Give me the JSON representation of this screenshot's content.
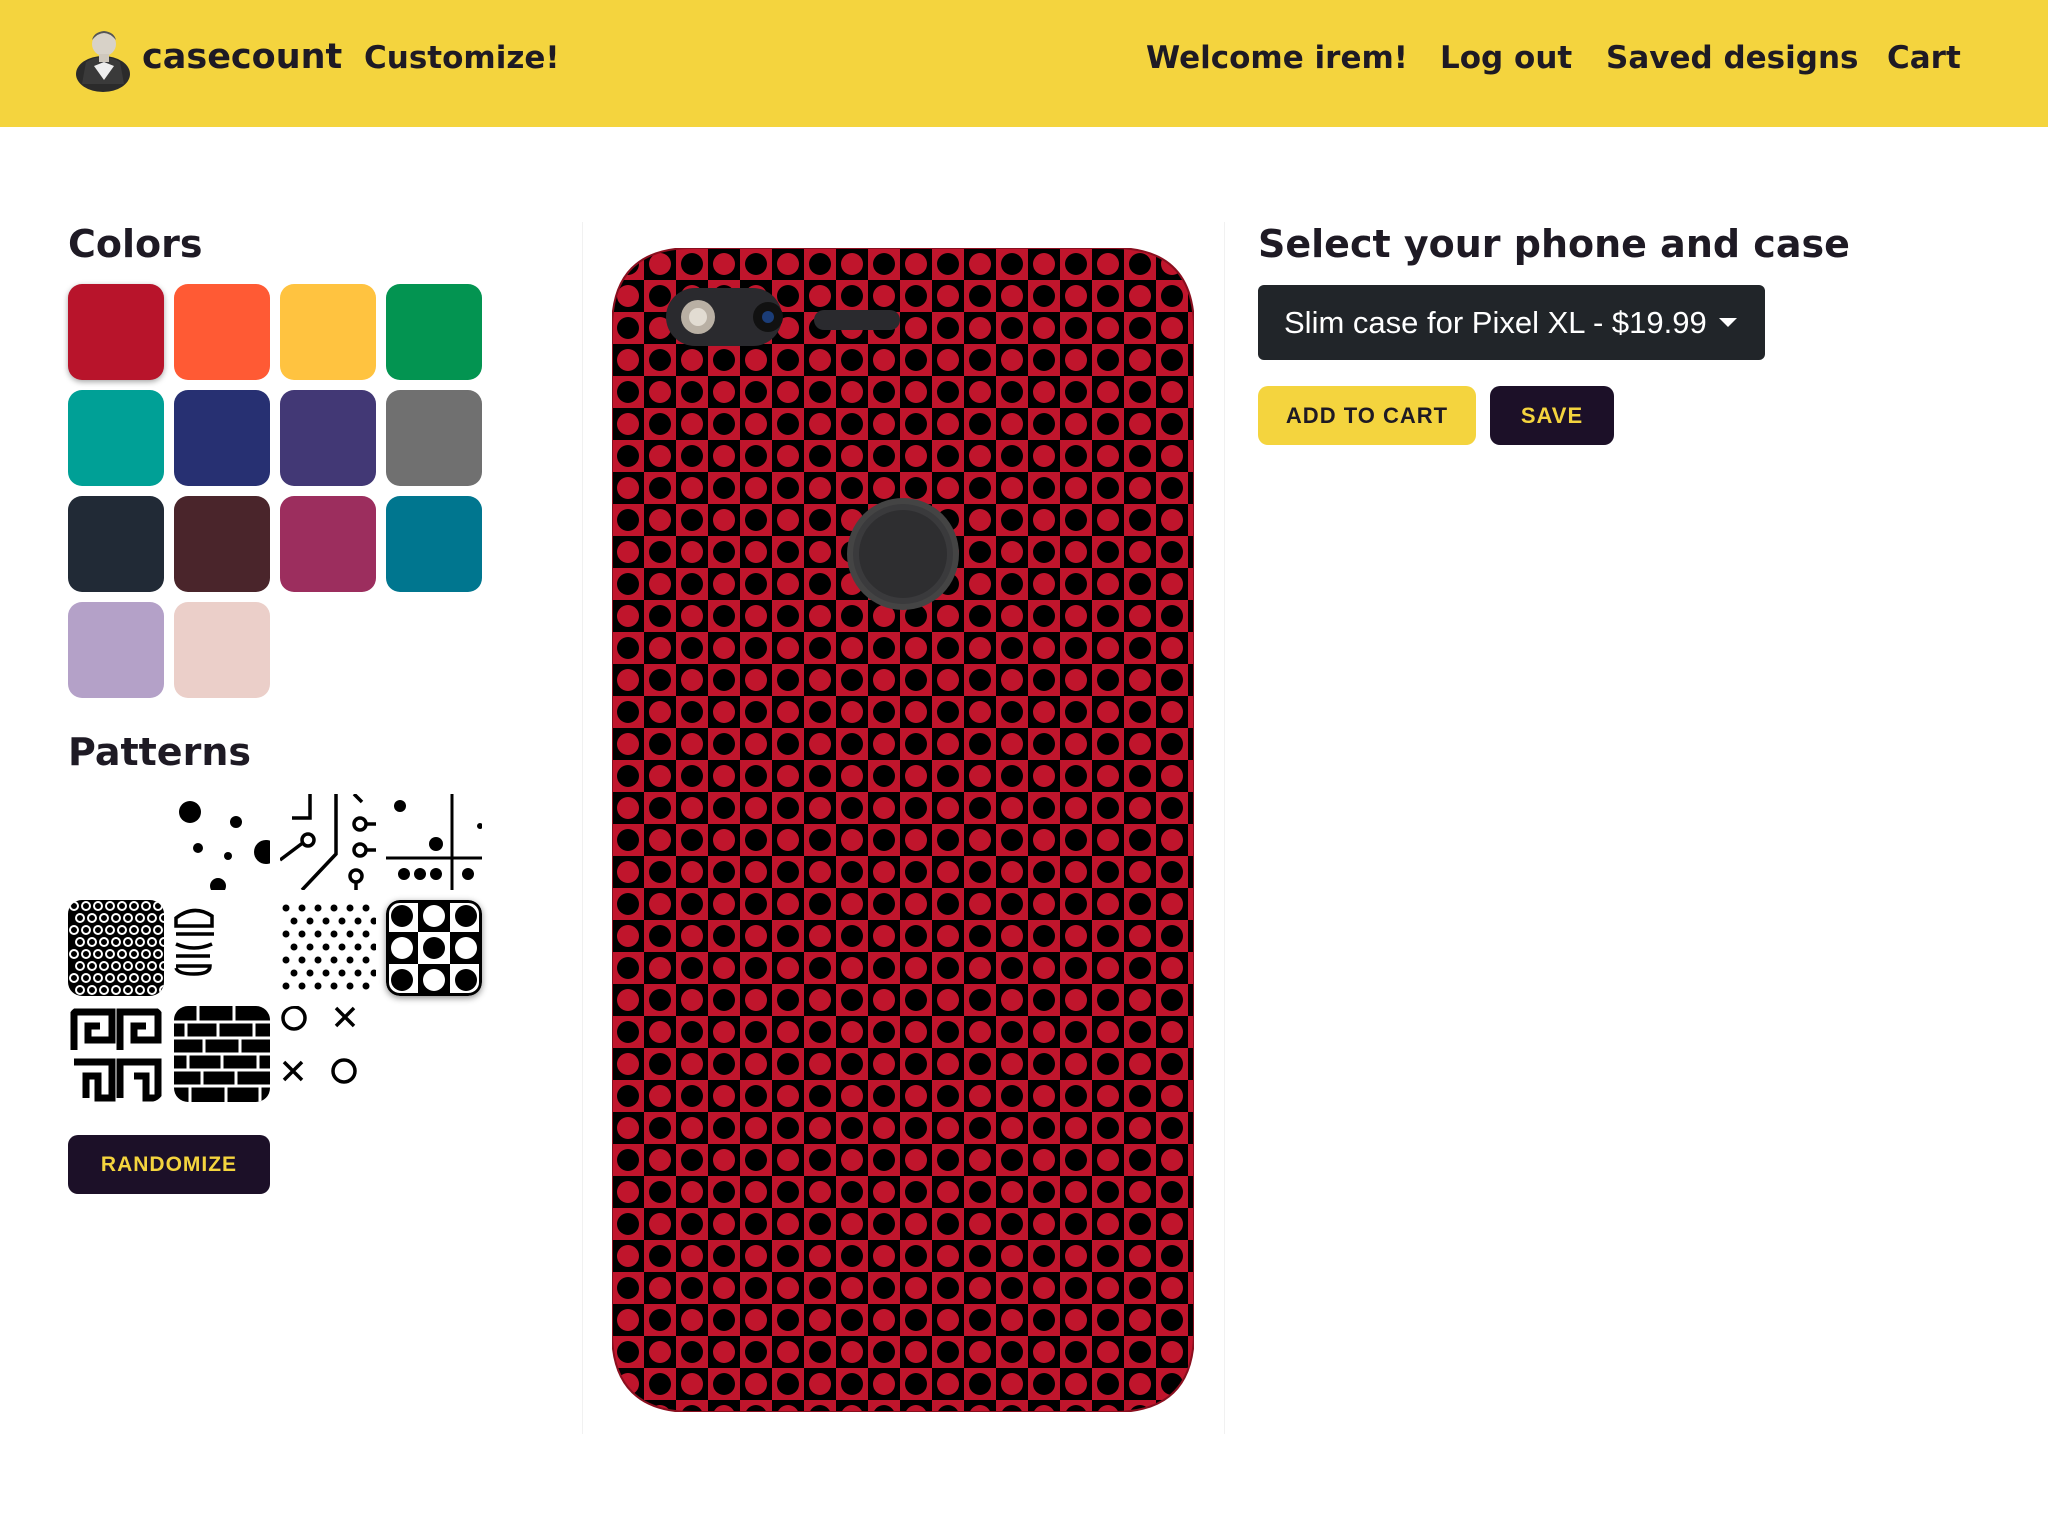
{
  "header": {
    "brand_name": "casecount",
    "brand_logo": "portrait-logo-icon",
    "nav_customize": "Customize!",
    "welcome": "Welcome irem!",
    "logout": "Log out",
    "saved_designs": "Saved designs",
    "cart": "Cart",
    "background_color": "#f4d43e"
  },
  "sidebar": {
    "colors_title": "Colors",
    "colors": [
      {
        "name": "crimson",
        "hex": "#b8142b",
        "selected": true
      },
      {
        "name": "orange",
        "hex": "#ff5a34"
      },
      {
        "name": "yellow",
        "hex": "#ffc340"
      },
      {
        "name": "green",
        "hex": "#039451"
      },
      {
        "name": "teal",
        "hex": "#00a096"
      },
      {
        "name": "navy",
        "hex": "#273072"
      },
      {
        "name": "indigo",
        "hex": "#423875"
      },
      {
        "name": "gray",
        "hex": "#707070"
      },
      {
        "name": "charcoal",
        "hex": "#212a36"
      },
      {
        "name": "maroon",
        "hex": "#4a252b"
      },
      {
        "name": "magenta",
        "hex": "#9c2e5e"
      },
      {
        "name": "petrol",
        "hex": "#00768f"
      },
      {
        "name": "lavender",
        "hex": "#b4a1c8"
      },
      {
        "name": "blush",
        "hex": "#ebcfc9"
      }
    ],
    "patterns_title": "Patterns",
    "patterns": [
      {
        "name": "none-pattern"
      },
      {
        "name": "scattered-dots-pattern"
      },
      {
        "name": "circuit-pattern"
      },
      {
        "name": "cross-dots-pattern"
      },
      {
        "name": "ring-grid-pattern"
      },
      {
        "name": "burger-line-pattern"
      },
      {
        "name": "polka-dots-pattern"
      },
      {
        "name": "checker-circles-pattern",
        "selected": true
      },
      {
        "name": "greek-key-pattern"
      },
      {
        "name": "bricks-pattern"
      },
      {
        "name": "tic-tac-toe-pattern"
      }
    ],
    "randomize_label": "RANDOMIZE"
  },
  "preview": {
    "case_color": "#c0152c",
    "pattern": "checker-circles-pattern",
    "pattern_color": "#000000"
  },
  "config": {
    "title": "Select your phone and case",
    "selected_case": "Slim case for Pixel XL - $19.99",
    "add_to_cart_label": "ADD TO CART",
    "save_label": "SAVE"
  }
}
